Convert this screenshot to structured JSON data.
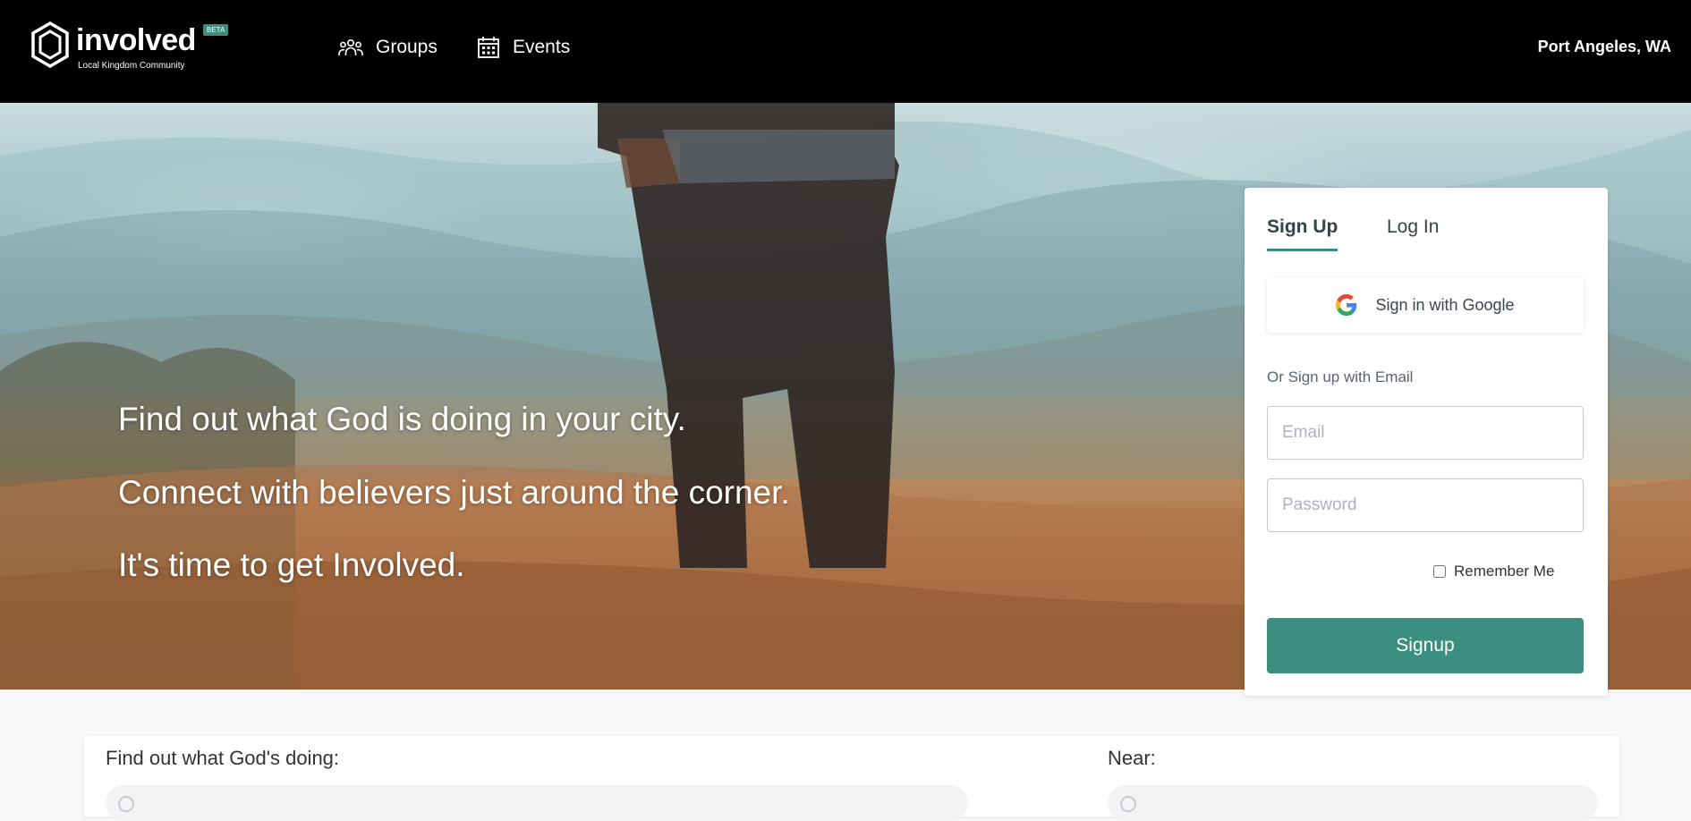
{
  "brand": {
    "name": "involved",
    "badge": "BETA",
    "tagline": "Local Kingdom Community"
  },
  "nav": {
    "items": [
      {
        "label": "Groups",
        "icon": "groups-icon"
      },
      {
        "label": "Events",
        "icon": "calendar-icon"
      }
    ],
    "location": "Port Angeles, WA"
  },
  "hero": {
    "lines": [
      "Find out what God is doing in your city.",
      "Connect with believers just around the corner.",
      "It's time to get Involved."
    ]
  },
  "auth": {
    "tabs": [
      "Sign Up",
      "Log In"
    ],
    "active_tab": "Sign Up",
    "google_label": "Sign in with Google",
    "or_text": "Or Sign up with Email",
    "email_placeholder": "Email",
    "password_placeholder": "Password",
    "remember_label": "Remember Me",
    "remember_checked": false,
    "submit_label": "Signup"
  },
  "search": {
    "what_label": "Find out what God's doing:",
    "near_label": "Near:"
  },
  "colors": {
    "accent": "#3a8f80",
    "nav_bg": "#000000"
  }
}
